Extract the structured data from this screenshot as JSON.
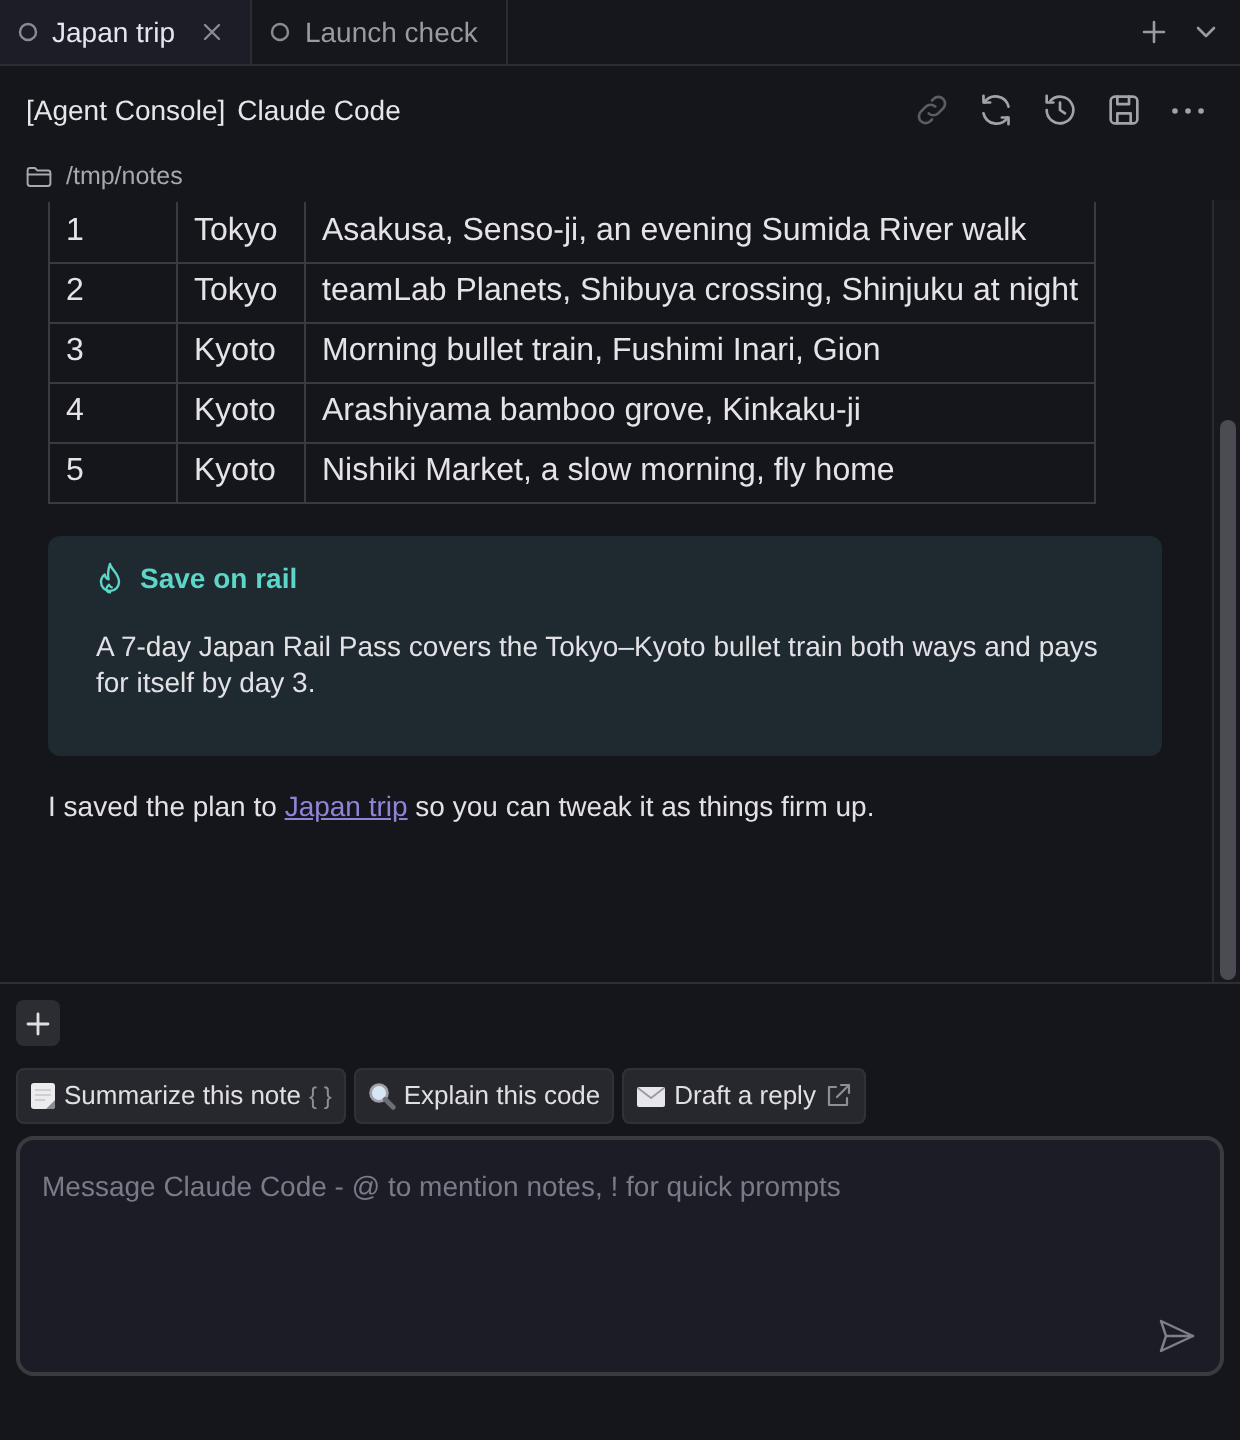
{
  "tabs": [
    {
      "label": "Japan trip",
      "selected": true
    },
    {
      "label": "Launch check",
      "selected": false
    }
  ],
  "header": {
    "context": "[Agent Console]",
    "title": "Claude Code",
    "actions": [
      {
        "kind": "link",
        "disabled": true
      },
      {
        "kind": "refresh",
        "disabled": false
      },
      {
        "kind": "history",
        "disabled": false
      },
      {
        "kind": "save",
        "disabled": false
      },
      {
        "kind": "more",
        "disabled": false
      }
    ]
  },
  "path": "/tmp/notes",
  "table": {
    "rows": [
      [
        "1",
        "Tokyo",
        "Asakusa, Senso-ji, an evening Sumida River walk"
      ],
      [
        "2",
        "Tokyo",
        "teamLab Planets, Shibuya crossing, Shinjuku at night"
      ],
      [
        "3",
        "Kyoto",
        "Morning bullet train, Fushimi Inari, Gion"
      ],
      [
        "4",
        "Kyoto",
        "Arashiyama bamboo grove, Kinkaku-ji"
      ],
      [
        "5",
        "Kyoto",
        "Nishiki Market, a slow morning, fly home"
      ]
    ]
  },
  "callout": {
    "title": "Save on rail",
    "body": "A 7-day Japan Rail Pass covers the Tokyo–Kyoto bullet train both ways and pays for itself by day 3."
  },
  "message": {
    "before": "I saved the plan to ",
    "link": "Japan trip",
    "after": " so you can tweak it as things firm up."
  },
  "quick_prompts": [
    {
      "kind": "memo",
      "label": "Summarize this note",
      "suffix": "{ }",
      "external": false
    },
    {
      "kind": "search",
      "label": "Explain this code",
      "external": false
    },
    {
      "kind": "mail",
      "label": "Draft a reply",
      "external": true
    }
  ],
  "composer": {
    "placeholder": "Message Claude Code - @ to mention notes, ! for quick prompts"
  }
}
